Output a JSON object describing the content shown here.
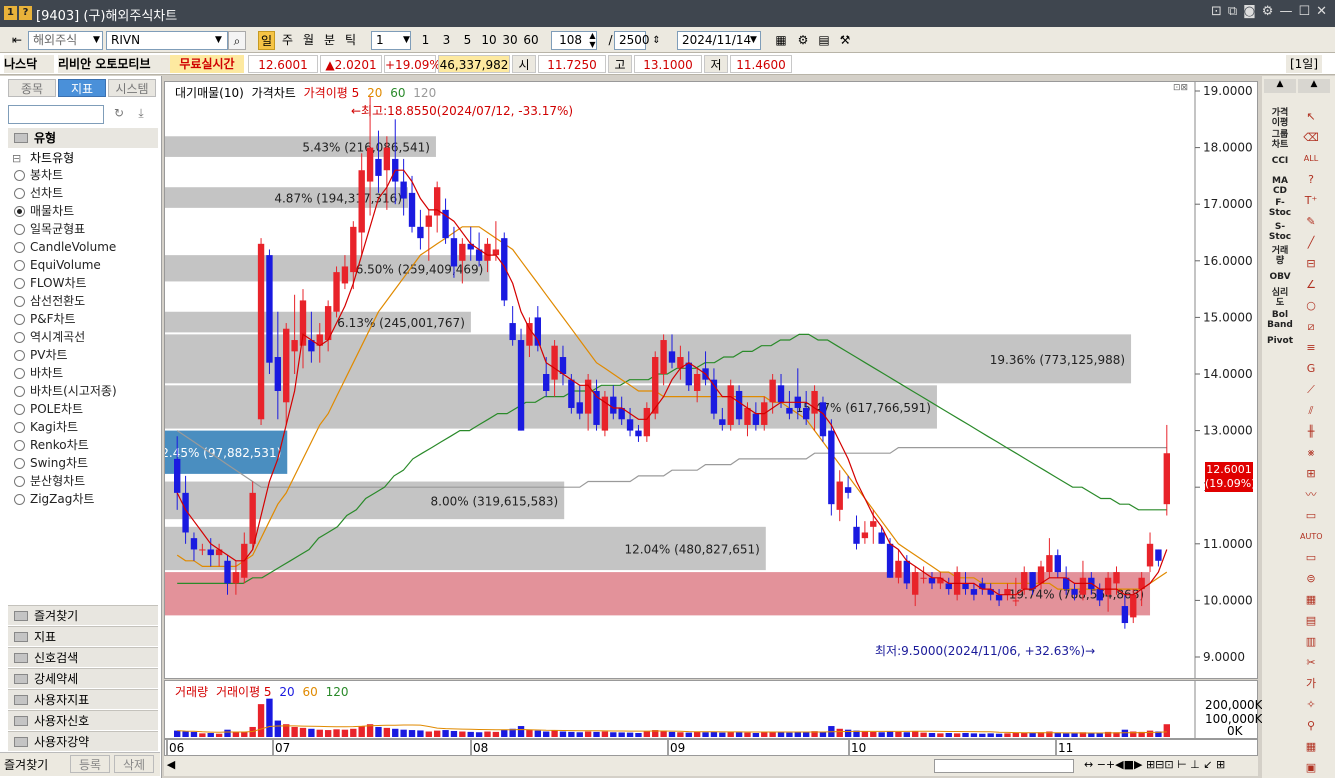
{
  "window": {
    "title": "[9403] (구)해외주식차트",
    "badges": [
      "1",
      "?"
    ]
  },
  "toolbar": {
    "market": "해외주식",
    "symbol": "RIVN",
    "periods": [
      "일",
      "주",
      "월",
      "분",
      "틱"
    ],
    "active_period": "일",
    "unit": "1",
    "minute_buttons": [
      "1",
      "3",
      "5",
      "10",
      "30",
      "60"
    ],
    "count": "108",
    "total": "2500",
    "date": "2024/11/14"
  },
  "quote": {
    "exchange": "나스닥",
    "name": "리비안 오토모티브",
    "realtime": "무료실시간",
    "price": "12.6001",
    "change": "▲2.0201",
    "change_pct": "+19.09%",
    "volume": "46,337,982",
    "open_label": "시",
    "open": "11.7250",
    "high_label": "고",
    "high": "13.1000",
    "low_label": "저",
    "low": "11.4600",
    "period_tag": "[1일]"
  },
  "left": {
    "tabs": [
      "종목",
      "지표",
      "시스템"
    ],
    "active_tab": "지표",
    "section": "유형",
    "group": "차트유형",
    "chart_types": [
      "봉차트",
      "선차트",
      "매물차트",
      "일목균형표",
      "CandleVolume",
      "EquiVolume",
      "FLOW차트",
      "삼선전환도",
      "P&F차트",
      "역시계곡선",
      "PV차트",
      "바차트",
      "바차트(시고저종)",
      "POLE차트",
      "Kagi차트",
      "Renko차트",
      "Swing차트",
      "분산형차트",
      "ZigZag차트"
    ],
    "selected_type": "매물차트",
    "sections": [
      "즐겨찾기",
      "지표",
      "신호검색",
      "강세약세",
      "사용자지표",
      "사용자신호",
      "사용자강약"
    ],
    "bottom_tabs": [
      "즐겨찾기",
      "등록",
      "삭제"
    ]
  },
  "legend": {
    "main": [
      "대기매물(10)",
      "가격차트",
      "가격이평 5",
      "20",
      "60",
      "120"
    ],
    "volume": [
      "거래량",
      "거래이평 5",
      "20",
      "60",
      "120"
    ]
  },
  "colors": {
    "up": "#e8232a",
    "down": "#1a1ae0",
    "ma5": "#d40000",
    "ma20": "#e08a00",
    "ma60": "#2a8a2a",
    "ma120": "#9a9a9a",
    "profile": "#c4c4c4",
    "profile_current": "#e3929a",
    "profile_low": "#4a8ec0"
  },
  "annotations": {
    "high": "←최고:18.8550(2024/07/12, -33.17%)",
    "low": "최저:9.5000(2024/11/06, +32.63%)→"
  },
  "current_price_tag": {
    "price": "12.6001",
    "pct": "(19.09%)"
  },
  "chart_data": {
    "type": "candlestick",
    "ylim": [
      9.0,
      19.0
    ],
    "y_ticks": [
      "19.0000",
      "18.0000",
      "17.0000",
      "16.0000",
      "15.0000",
      "14.0000",
      "13.0000",
      "12.0000",
      "11.0000",
      "10.0000",
      "9.0000"
    ],
    "x_labels": [
      "06",
      "07",
      "08",
      "09",
      "10",
      "11"
    ],
    "volume_ticks": [
      "200,000K",
      "100,000K",
      "0K"
    ],
    "price_levels": [
      {
        "low": 17.8,
        "high": 18.2,
        "label": "5.43% (216,086,541)",
        "highlight": "none"
      },
      {
        "low": 16.9,
        "high": 17.3,
        "label": "4.87% (194,317,316)",
        "highlight": "none"
      },
      {
        "low": 15.6,
        "high": 16.1,
        "label": "6.50% (259,409,469)",
        "highlight": "none"
      },
      {
        "low": 14.7,
        "high": 15.1,
        "label": "6.13% (245,001,767)",
        "highlight": "none"
      },
      {
        "low": 13.8,
        "high": 14.7,
        "label": "19.36% (773,125,988)",
        "highlight": "none"
      },
      {
        "low": 13.0,
        "high": 13.8,
        "label": "15.47% (617,766,591)",
        "highlight": "none"
      },
      {
        "low": 12.2,
        "high": 13.0,
        "label": "2.45% (97,882,531)",
        "highlight": "low"
      },
      {
        "low": 11.4,
        "high": 12.1,
        "label": "8.00% (319,615,583)",
        "highlight": "none"
      },
      {
        "low": 10.5,
        "high": 11.3,
        "label": "12.04% (480,827,651)",
        "highlight": "none"
      },
      {
        "low": 9.7,
        "high": 10.5,
        "label": "19.74% (788,564,868)",
        "highlight": "current"
      }
    ],
    "candles": [
      [
        12.5,
        12.9,
        11.6,
        11.9
      ],
      [
        11.9,
        12.2,
        11.0,
        11.2
      ],
      [
        11.1,
        11.2,
        10.7,
        10.9
      ],
      [
        10.9,
        11.0,
        10.8,
        10.9
      ],
      [
        10.9,
        11.1,
        10.6,
        10.8
      ],
      [
        10.8,
        11.0,
        10.6,
        10.9
      ],
      [
        10.7,
        10.8,
        10.1,
        10.3
      ],
      [
        10.3,
        10.7,
        10.1,
        10.5
      ],
      [
        10.4,
        11.2,
        10.3,
        11.0
      ],
      [
        11.0,
        12.1,
        10.9,
        11.9
      ],
      [
        13.2,
        16.4,
        13.1,
        16.3
      ],
      [
        16.1,
        16.2,
        14.0,
        14.2
      ],
      [
        14.3,
        15.1,
        13.2,
        13.7
      ],
      [
        13.5,
        14.9,
        13.1,
        14.8
      ],
      [
        14.4,
        15.4,
        14.0,
        14.6
      ],
      [
        14.5,
        15.5,
        14.1,
        15.3
      ],
      [
        14.6,
        15.1,
        14.2,
        14.4
      ],
      [
        14.5,
        14.9,
        14.2,
        14.7
      ],
      [
        14.6,
        15.3,
        14.4,
        15.2
      ],
      [
        15.1,
        15.9,
        15.0,
        15.8
      ],
      [
        15.6,
        16.1,
        15.5,
        15.9
      ],
      [
        15.8,
        16.7,
        15.5,
        16.6
      ],
      [
        16.5,
        17.9,
        16.1,
        17.6
      ],
      [
        17.4,
        18.9,
        16.8,
        18.0
      ],
      [
        17.8,
        18.3,
        17.2,
        17.5
      ],
      [
        17.6,
        18.2,
        16.9,
        18.0
      ],
      [
        17.8,
        18.5,
        17.0,
        17.4
      ],
      [
        17.4,
        17.8,
        16.8,
        17.1
      ],
      [
        17.2,
        17.5,
        16.5,
        16.6
      ],
      [
        16.6,
        16.9,
        16.2,
        16.4
      ],
      [
        16.6,
        16.9,
        16.0,
        16.8
      ],
      [
        16.8,
        17.4,
        16.5,
        17.3
      ],
      [
        16.9,
        17.1,
        16.3,
        16.4
      ],
      [
        16.4,
        16.6,
        15.7,
        15.9
      ],
      [
        16.0,
        16.4,
        15.6,
        16.3
      ],
      [
        16.3,
        16.6,
        16.0,
        16.2
      ],
      [
        16.2,
        16.5,
        15.9,
        16.0
      ],
      [
        16.0,
        16.4,
        15.8,
        16.3
      ],
      [
        16.1,
        16.7,
        16.0,
        16.2
      ],
      [
        16.4,
        16.5,
        15.2,
        15.3
      ],
      [
        14.9,
        15.2,
        14.5,
        14.6
      ],
      [
        14.6,
        14.8,
        13.0,
        13.0
      ],
      [
        14.5,
        15.0,
        14.3,
        14.9
      ],
      [
        15.0,
        15.2,
        14.4,
        14.5
      ],
      [
        14.0,
        14.3,
        13.6,
        13.7
      ],
      [
        13.9,
        14.6,
        13.6,
        14.5
      ],
      [
        14.3,
        14.5,
        13.8,
        14.0
      ],
      [
        13.9,
        14.0,
        13.3,
        13.4
      ],
      [
        13.5,
        13.8,
        13.2,
        13.3
      ],
      [
        13.3,
        14.0,
        13.0,
        13.9
      ],
      [
        13.7,
        13.9,
        13.0,
        13.1
      ],
      [
        13.0,
        13.7,
        12.9,
        13.6
      ],
      [
        13.6,
        13.8,
        13.2,
        13.3
      ],
      [
        13.4,
        13.6,
        13.1,
        13.2
      ],
      [
        13.2,
        13.4,
        12.9,
        13.0
      ],
      [
        13.0,
        13.1,
        12.8,
        12.9
      ],
      [
        12.9,
        13.5,
        12.8,
        13.4
      ],
      [
        13.3,
        14.4,
        13.2,
        14.3
      ],
      [
        14.0,
        14.7,
        13.8,
        14.6
      ],
      [
        14.4,
        14.7,
        14.1,
        14.2
      ],
      [
        14.1,
        14.5,
        13.9,
        14.3
      ],
      [
        14.2,
        14.4,
        13.7,
        13.8
      ],
      [
        13.7,
        14.1,
        13.5,
        14.0
      ],
      [
        14.1,
        14.4,
        13.8,
        13.9
      ],
      [
        13.9,
        14.1,
        13.2,
        13.3
      ],
      [
        13.2,
        13.4,
        13.0,
        13.1
      ],
      [
        13.1,
        13.9,
        13.0,
        13.8
      ],
      [
        13.7,
        13.8,
        13.1,
        13.2
      ],
      [
        13.1,
        13.5,
        12.9,
        13.4
      ],
      [
        13.3,
        13.5,
        13.0,
        13.1
      ],
      [
        13.1,
        13.6,
        13.0,
        13.5
      ],
      [
        13.5,
        14.0,
        13.3,
        13.9
      ],
      [
        13.8,
        14.0,
        13.4,
        13.5
      ],
      [
        13.4,
        13.7,
        13.2,
        13.3
      ],
      [
        13.6,
        14.1,
        13.2,
        13.4
      ],
      [
        13.4,
        13.7,
        13.1,
        13.2
      ],
      [
        13.3,
        13.8,
        13.0,
        13.7
      ],
      [
        13.5,
        13.6,
        12.8,
        12.9
      ],
      [
        13.0,
        13.2,
        11.5,
        11.7
      ],
      [
        11.6,
        12.3,
        11.4,
        12.1
      ],
      [
        12.0,
        12.2,
        11.8,
        11.9
      ],
      [
        11.3,
        11.5,
        10.9,
        11.0
      ],
      [
        11.1,
        11.4,
        11.0,
        11.2
      ],
      [
        11.3,
        11.6,
        11.0,
        11.4
      ],
      [
        11.2,
        11.3,
        11.0,
        11.0
      ],
      [
        11.0,
        11.1,
        10.4,
        10.4
      ],
      [
        10.4,
        10.9,
        10.3,
        10.7
      ],
      [
        10.7,
        10.8,
        10.2,
        10.3
      ],
      [
        10.1,
        10.6,
        9.9,
        10.5
      ],
      [
        10.4,
        10.6,
        10.3,
        10.4
      ],
      [
        10.4,
        10.5,
        10.2,
        10.3
      ],
      [
        10.3,
        10.5,
        10.2,
        10.4
      ],
      [
        10.3,
        10.4,
        10.1,
        10.2
      ],
      [
        10.1,
        10.6,
        10.0,
        10.5
      ],
      [
        10.3,
        10.5,
        10.1,
        10.2
      ],
      [
        10.2,
        10.3,
        10.0,
        10.1
      ],
      [
        10.3,
        10.4,
        10.1,
        10.2
      ],
      [
        10.2,
        10.3,
        10.0,
        10.1
      ],
      [
        10.1,
        10.2,
        9.9,
        10.0
      ],
      [
        10.1,
        10.3,
        10.0,
        10.2
      ],
      [
        10.0,
        10.4,
        9.9,
        10.0
      ],
      [
        10.2,
        10.6,
        10.1,
        10.5
      ],
      [
        10.5,
        10.5,
        10.1,
        10.2
      ],
      [
        10.3,
        10.7,
        10.2,
        10.6
      ],
      [
        10.5,
        11.1,
        10.4,
        10.8
      ],
      [
        10.8,
        10.9,
        10.4,
        10.5
      ],
      [
        10.4,
        10.6,
        10.1,
        10.2
      ],
      [
        10.2,
        10.3,
        10.0,
        10.1
      ],
      [
        10.1,
        10.7,
        10.0,
        10.4
      ],
      [
        10.4,
        10.5,
        10.1,
        10.2
      ],
      [
        10.2,
        10.3,
        9.9,
        10.0
      ],
      [
        10.1,
        10.5,
        9.8,
        10.4
      ],
      [
        10.3,
        10.6,
        10.1,
        10.5
      ],
      [
        9.9,
        10.1,
        9.5,
        9.6
      ],
      [
        9.7,
        10.2,
        9.6,
        10.1
      ],
      [
        10.2,
        10.5,
        9.9,
        10.4
      ],
      [
        10.6,
        11.2,
        10.5,
        11.0
      ],
      [
        10.9,
        10.9,
        10.6,
        10.7
      ],
      [
        11.7,
        13.1,
        11.5,
        12.6
      ]
    ],
    "ma5": [
      11.9,
      11.6,
      11.4,
      11.2,
      11.0,
      10.9,
      10.8,
      10.7,
      10.7,
      10.9,
      11.5,
      12.1,
      12.5,
      13.1,
      13.7,
      14.7,
      14.6,
      14.5,
      14.6,
      14.9,
      15.2,
      15.6,
      16.1,
      16.6,
      17.1,
      17.3,
      17.6,
      17.6,
      17.4,
      17.1,
      16.9,
      16.9,
      16.8,
      16.7,
      16.5,
      16.3,
      16.2,
      16.1,
      16.1,
      15.9,
      15.6,
      15.1,
      14.8,
      14.6,
      14.2,
      14.1,
      14.0,
      13.9,
      13.8,
      13.8,
      13.6,
      13.5,
      13.4,
      13.4,
      13.3,
      13.2,
      13.2,
      13.4,
      13.6,
      13.9,
      14.1,
      14.2,
      14.1,
      14.0,
      13.8,
      13.6,
      13.6,
      13.5,
      13.4,
      13.3,
      13.3,
      13.4,
      13.5,
      13.5,
      13.5,
      13.5,
      13.4,
      13.3,
      13.1,
      12.8,
      12.5,
      12.1,
      11.8,
      11.5,
      11.3,
      11.0,
      10.9,
      10.7,
      10.6,
      10.5,
      10.4,
      10.4,
      10.3,
      10.3,
      10.3,
      10.3,
      10.2,
      10.2,
      10.1,
      10.1,
      10.1,
      10.2,
      10.2,
      10.3,
      10.4,
      10.4,
      10.4,
      10.3,
      10.3,
      10.3,
      10.2,
      10.2,
      10.2,
      10.1,
      10.1,
      10.2,
      10.3,
      10.5,
      10.9
    ],
    "ma20": [
      10.8,
      10.7,
      10.7,
      10.6,
      10.6,
      10.6,
      10.6,
      10.6,
      10.7,
      10.8,
      11.1,
      11.4,
      11.7,
      11.9,
      12.2,
      12.5,
      12.8,
      13.1,
      13.3,
      13.6,
      13.9,
      14.2,
      14.5,
      14.8,
      15.1,
      15.3,
      15.5,
      15.7,
      15.9,
      16.1,
      16.2,
      16.3,
      16.4,
      16.5,
      16.6,
      16.6,
      16.6,
      16.5,
      16.4,
      16.3,
      16.2,
      16.0,
      15.8,
      15.6,
      15.4,
      15.2,
      15.0,
      14.8,
      14.6,
      14.4,
      14.2,
      14.1,
      14.0,
      13.9,
      13.8,
      13.7,
      13.7,
      13.7,
      13.6,
      13.6,
      13.6,
      13.6,
      13.6,
      13.6,
      13.6,
      13.6,
      13.6,
      13.6,
      13.6,
      13.6,
      13.6,
      13.5,
      13.5,
      13.4,
      13.3,
      13.2,
      13.0,
      12.8,
      12.6,
      12.4,
      12.2,
      12.0,
      11.8,
      11.6,
      11.4,
      11.2,
      11.0,
      10.9,
      10.8,
      10.7,
      10.6,
      10.5,
      10.5,
      10.4,
      10.4,
      10.4,
      10.3,
      10.3,
      10.3,
      10.3,
      10.3,
      10.3,
      10.3,
      10.3,
      10.3,
      10.2,
      10.2,
      10.2,
      10.2,
      10.2,
      10.2,
      10.2,
      10.2,
      10.2,
      10.2,
      10.2,
      10.3,
      10.4,
      10.5
    ],
    "ma60": [
      10.3,
      10.3,
      10.3,
      10.3,
      10.3,
      10.3,
      10.3,
      10.3,
      10.4,
      10.4,
      10.5,
      10.6,
      10.7,
      10.8,
      10.9,
      11.1,
      11.2,
      11.3,
      11.5,
      11.6,
      11.8,
      11.9,
      12.0,
      12.2,
      12.3,
      12.5,
      12.6,
      12.7,
      12.8,
      12.9,
      13.0,
      13.0,
      13.1,
      13.2,
      13.3,
      13.3,
      13.4,
      13.5,
      13.5,
      13.6,
      13.6,
      13.6,
      13.7,
      13.7,
      13.7,
      13.8,
      13.8,
      13.8,
      13.9,
      13.9,
      13.9,
      14.0,
      14.0,
      14.1,
      14.1,
      14.1,
      14.2,
      14.2,
      14.3,
      14.3,
      14.4,
      14.4,
      14.5,
      14.5,
      14.6,
      14.6,
      14.7,
      14.7,
      14.6,
      14.6,
      14.5,
      14.4,
      14.3,
      14.2,
      14.1,
      14.0,
      13.9,
      13.8,
      13.7,
      13.6,
      13.5,
      13.4,
      13.3,
      13.2,
      13.1,
      13.0,
      12.9,
      12.8,
      12.7,
      12.6,
      12.5,
      12.4,
      12.3,
      12.2,
      12.1,
      12.0,
      12.0,
      11.9,
      11.8,
      11.8,
      11.7,
      11.7,
      11.6,
      11.6,
      11.6,
      11.6
    ],
    "ma120": [
      13.0,
      12.9,
      12.8,
      12.7,
      12.6,
      12.5,
      12.4,
      12.3,
      12.2,
      12.1,
      12.0,
      12.0,
      12.0,
      12.0,
      12.0,
      12.0,
      12.0,
      12.0,
      12.0,
      12.0,
      12.0,
      12.0,
      12.0,
      12.0,
      12.0,
      12.0,
      12.0,
      12.0,
      12.0,
      12.0,
      12.0,
      12.0,
      12.0,
      12.0,
      12.0,
      12.0,
      12.0,
      12.0,
      12.0,
      12.0,
      12.0,
      12.0,
      12.0,
      12.0,
      12.0,
      12.0,
      12.0,
      12.0,
      12.0,
      12.1,
      12.1,
      12.1,
      12.1,
      12.1,
      12.1,
      12.2,
      12.2,
      12.2,
      12.2,
      12.3,
      12.3,
      12.3,
      12.3,
      12.4,
      12.4,
      12.4,
      12.4,
      12.5,
      12.5,
      12.5,
      12.5,
      12.5,
      12.5,
      12.5,
      12.5,
      12.5,
      12.6,
      12.6,
      12.6,
      12.6,
      12.6,
      12.6,
      12.6,
      12.6,
      12.6,
      12.6,
      12.7,
      12.7,
      12.7,
      12.7,
      12.7,
      12.7,
      12.7,
      12.7,
      12.7,
      12.7,
      12.7,
      12.7,
      12.7,
      12.7,
      12.7,
      12.7,
      12.7,
      12.7,
      12.7,
      12.7,
      12.7,
      12.7,
      12.7,
      12.7,
      12.7,
      12.7,
      12.7,
      12.7,
      12.7,
      12.7,
      12.7,
      12.7,
      12.7
    ],
    "volume_k": [
      35,
      30,
      28,
      20,
      22,
      18,
      40,
      25,
      30,
      55,
      180,
      210,
      90,
      70,
      55,
      50,
      45,
      40,
      38,
      42,
      40,
      45,
      60,
      70,
      55,
      50,
      45,
      40,
      38,
      36,
      30,
      35,
      38,
      33,
      30,
      28,
      26,
      30,
      28,
      40,
      45,
      60,
      40,
      35,
      30,
      38,
      30,
      28,
      26,
      30,
      28,
      30,
      26,
      25,
      24,
      22,
      30,
      38,
      35,
      28,
      26,
      24,
      28,
      26,
      30,
      24,
      28,
      26,
      24,
      22,
      28,
      30,
      26,
      24,
      28,
      26,
      32,
      30,
      60,
      45,
      40,
      35,
      30,
      28,
      26,
      30,
      28,
      26,
      30,
      24,
      22,
      20,
      22,
      20,
      22,
      20,
      18,
      20,
      18,
      20,
      22,
      24,
      22,
      26,
      30,
      24,
      20,
      20,
      26,
      22,
      20,
      28,
      26,
      40,
      30,
      28,
      35,
      30,
      70
    ]
  }
}
